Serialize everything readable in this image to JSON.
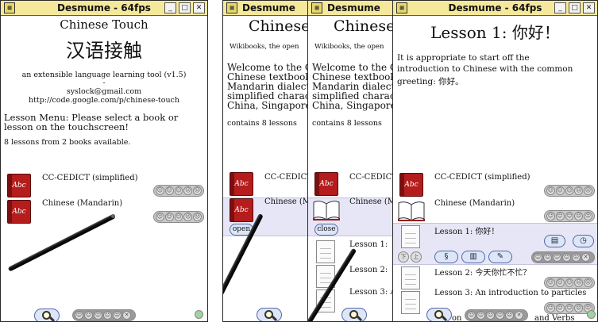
{
  "windows": [
    {
      "title": "Desmume - 64fps",
      "app_title": "Chinese Touch",
      "app_title_cn": "汉语接触",
      "subtitle": "an extensible language learning tool (v1.5)",
      "dash": "-",
      "email": "syslock@gmail.com",
      "url": "http://code.google.com/p/chinese-touch",
      "menu_text_1": "Lesson Menu: Please select a book or",
      "menu_text_2": "lesson on the touchscreen!",
      "count_text": "8 lessons from 2 books available.",
      "book_1": "CC-CEDICT (simplified)",
      "book_2": "Chinese (Mandarin)"
    },
    {
      "title": "Desmume",
      "heading": "Chinese",
      "wikibooks": "Wikibooks, the open",
      "welcome_1": "Welcome to the C",
      "welcome_2": "Chinese textbook",
      "welcome_3": "Mandarin dialect",
      "welcome_4": "simplified charac",
      "welcome_5": "China, Singapore",
      "contains": "contains 8 lessons",
      "book_1": "CC-CEDICT",
      "book_2": "Chinese (M",
      "open_btn": "open"
    },
    {
      "title": "Desmume",
      "heading": "Chinese",
      "wikibooks": "Wikibooks, the open",
      "welcome_1": "Welcome to the C",
      "welcome_2": "Chinese textbook",
      "welcome_3": "Mandarin dialect",
      "welcome_4": "simplified charac",
      "welcome_5": "China, Singapore",
      "contains": "contains 8 lessons",
      "book_1": "CC-CEDICT",
      "book_2": "Chinese (M",
      "close_btn": "close",
      "lesson_1": "Lesson 1:",
      "lesson_2": "Lesson 2:",
      "lesson_3": "Lesson 3: A"
    },
    {
      "title": "Desmume - 64fps",
      "lesson_title": "Lesson 1: 你好！",
      "intro_1": "It is appropriate to start off the",
      "intro_2": "introduction to Chinese with the common",
      "intro_3": "greeting: 你好。",
      "book_1": "CC-CEDICT (simplified)",
      "book_2": "Chinese (Mandarin)",
      "lesson_1": "Lesson 1: 你好！",
      "lesson_2": "Lesson 2: 今天你忙不忙？",
      "lesson_3": "Lesson 3: An introduction to particles",
      "bottom_1": "on",
      "bottom_2": "and Verbs"
    }
  ],
  "colors": {
    "titlebar": "#f6e89a",
    "highlight_row": "#e6e6f6",
    "book_red": "#b51c1c",
    "button_fill": "#dde6f6",
    "button_border": "#5566aa"
  },
  "icons": [
    "book-icon",
    "open-book-icon",
    "document-icon",
    "search-icon",
    "smiley-rating-icon",
    "stylus-icon",
    "minimize-icon",
    "maximize-icon",
    "close-icon"
  ]
}
